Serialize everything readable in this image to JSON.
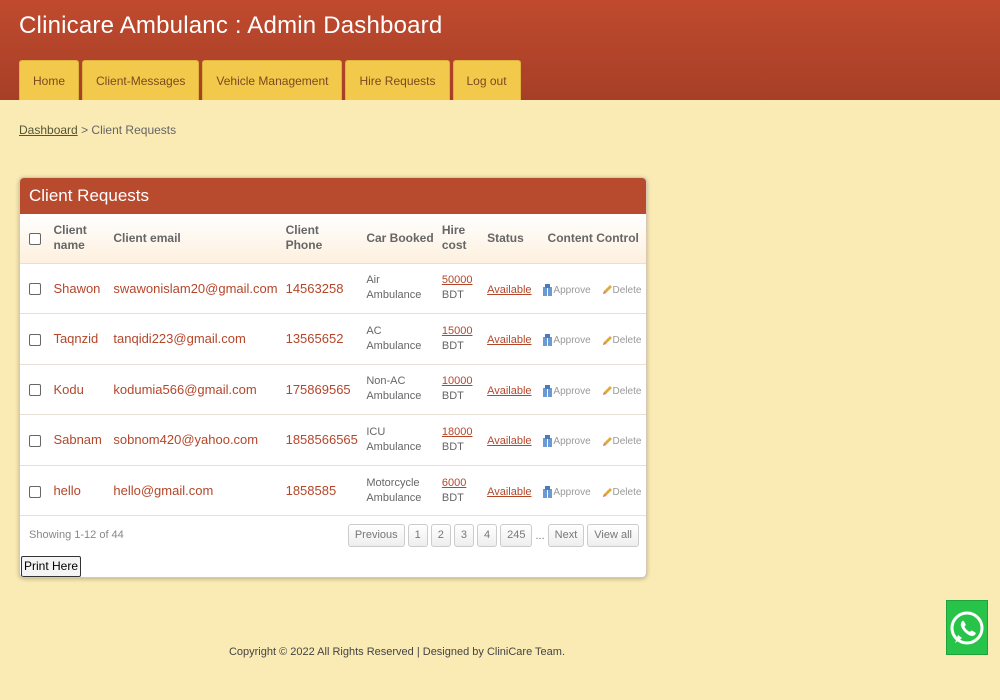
{
  "header": {
    "title": "Clinicare Ambulanc : Admin Dashboard"
  },
  "nav": [
    {
      "label": "Home"
    },
    {
      "label": "Client-Messages"
    },
    {
      "label": "Vehicle Management"
    },
    {
      "label": "Hire Requests"
    },
    {
      "label": "Log out"
    }
  ],
  "breadcrumb": {
    "link": "Dashboard",
    "separator": ">",
    "current": "Client Requests"
  },
  "panel": {
    "title": "Client Requests",
    "columns": {
      "name": "Client name",
      "email": "Client email",
      "phone": "Client Phone",
      "car": "Car Booked",
      "cost": "Hire cost",
      "status": "Status",
      "control": "Content Control"
    },
    "rows": [
      {
        "name": "Shawon",
        "email": "swawonislam20@gmail.com",
        "phone": "14563258",
        "car": "Air Ambulance",
        "cost": "50000",
        "currency": "BDT",
        "status": "Available",
        "approve": "Approve",
        "delete": "Delete"
      },
      {
        "name": "Taqnzid",
        "email": "tanqidi223@gmail.com",
        "phone": "13565652",
        "car": "AC Ambulance",
        "cost": "15000",
        "currency": "BDT",
        "status": "Available",
        "approve": "Approve",
        "delete": "Delete"
      },
      {
        "name": "Kodu",
        "email": "kodumia566@gmail.com",
        "phone": "175869565",
        "car": "Non-AC Ambulance",
        "cost": "10000",
        "currency": "BDT",
        "status": "Available",
        "approve": "Approve",
        "delete": "Delete"
      },
      {
        "name": "Sabnam",
        "email": "sobnom420@yahoo.com",
        "phone": "1858566565",
        "car": "ICU Ambulance",
        "cost": "18000",
        "currency": "BDT",
        "status": "Available",
        "approve": "Approve",
        "delete": "Delete"
      },
      {
        "name": "hello",
        "email": "hello@gmail.com",
        "phone": "1858585",
        "car": "Motorcycle Ambulance",
        "cost": "6000",
        "currency": "BDT",
        "status": "Available",
        "approve": "Approve",
        "delete": "Delete"
      }
    ],
    "showing": "Showing 1-12 of 44",
    "pagination": {
      "previous": "Previous",
      "pages": [
        "1",
        "2",
        "3",
        "4",
        "245"
      ],
      "ellipsis": "...",
      "next": "Next",
      "view_all": "View all"
    },
    "print_label": "Print Here"
  },
  "footer": {
    "copyright": "Copyright © 2022 All Rights Reserved | Designed by CliniCare Team."
  },
  "colors": {
    "header": "#b84a2d",
    "tab": "#f3c94b",
    "page_bg": "#faeab4",
    "link_red": "#b4462a",
    "whatsapp": "#28c44a"
  },
  "icons": {
    "approve": "approve-icon",
    "delete": "pencil-icon",
    "chat": "whatsapp-icon"
  }
}
